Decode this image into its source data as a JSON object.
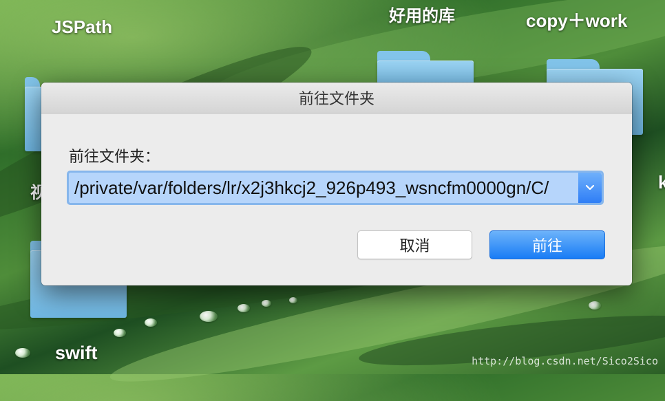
{
  "desktop": {
    "labels": {
      "jspath": "JSPath",
      "haoyong": "好用的库",
      "copywork": "copy＋work",
      "swift": "swift",
      "left_partial": "视",
      "right_partial": "k"
    },
    "watermark": "http://blog.csdn.net/Sico2Sico"
  },
  "dialog": {
    "title": "前往文件夹",
    "prompt": "前往文件夹：",
    "path_value": "/private/var/folders/lr/x2j3hkcj2_926p493_wsncfm0000gn/C/",
    "cancel_label": "取消",
    "go_label": "前往"
  },
  "colors": {
    "accent": "#197cf5",
    "focus_ring": "#86b6ec",
    "selection": "#b6d5fb",
    "folder": "#82c4ea"
  },
  "icons": {
    "combo": "chevron-down-icon",
    "folder": "folder-icon"
  }
}
